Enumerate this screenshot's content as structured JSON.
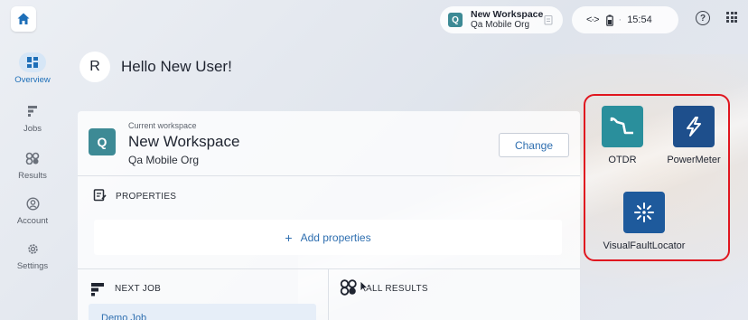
{
  "topbar": {
    "home_icon": "home-icon",
    "workspace": {
      "avatar_letter": "Q",
      "name": "New Workspace",
      "org": "Qa Mobile Org"
    },
    "status": {
      "connection_icon": "connection-arrows-icon",
      "battery_icon": "battery-icon",
      "time": "15:54"
    },
    "help_icon": "help-circle-icon",
    "apps_grid_icon": "apps-grid-icon"
  },
  "sidebar": {
    "items": [
      {
        "label": "Overview",
        "icon": "dashboard-icon",
        "active": true
      },
      {
        "label": "Jobs",
        "icon": "jobs-icon",
        "active": false
      },
      {
        "label": "Results",
        "icon": "results-icon",
        "active": false
      },
      {
        "label": "Account",
        "icon": "account-icon",
        "active": false
      },
      {
        "label": "Settings",
        "icon": "settings-gear-icon",
        "active": false
      }
    ]
  },
  "greeting": {
    "avatar_letter": "R",
    "text": "Hello New User!"
  },
  "workspace_card": {
    "caption": "Current workspace",
    "avatar_letter": "Q",
    "name": "New Workspace",
    "org": "Qa Mobile Org",
    "change_label": "Change"
  },
  "properties": {
    "label": "PROPERTIES",
    "add_label": "Add properties"
  },
  "next_job": {
    "label": "NEXT JOB",
    "first_job": "Demo Job"
  },
  "all_results": {
    "label": "ALL RESULTS"
  },
  "apps": [
    {
      "name": "OTDR",
      "color": "#2a8f9c",
      "icon": "otdr-trace-icon"
    },
    {
      "name": "PowerMeter",
      "color": "#1e4f8c",
      "icon": "lightning-icon"
    },
    {
      "name": "VisualFaultLocator",
      "color": "#1e5a9c",
      "icon": "laser-burst-icon"
    }
  ],
  "colors": {
    "accent": "#1e6fb8",
    "highlight_border": "#e0161f",
    "workspace_teal": "#3d8a95"
  }
}
